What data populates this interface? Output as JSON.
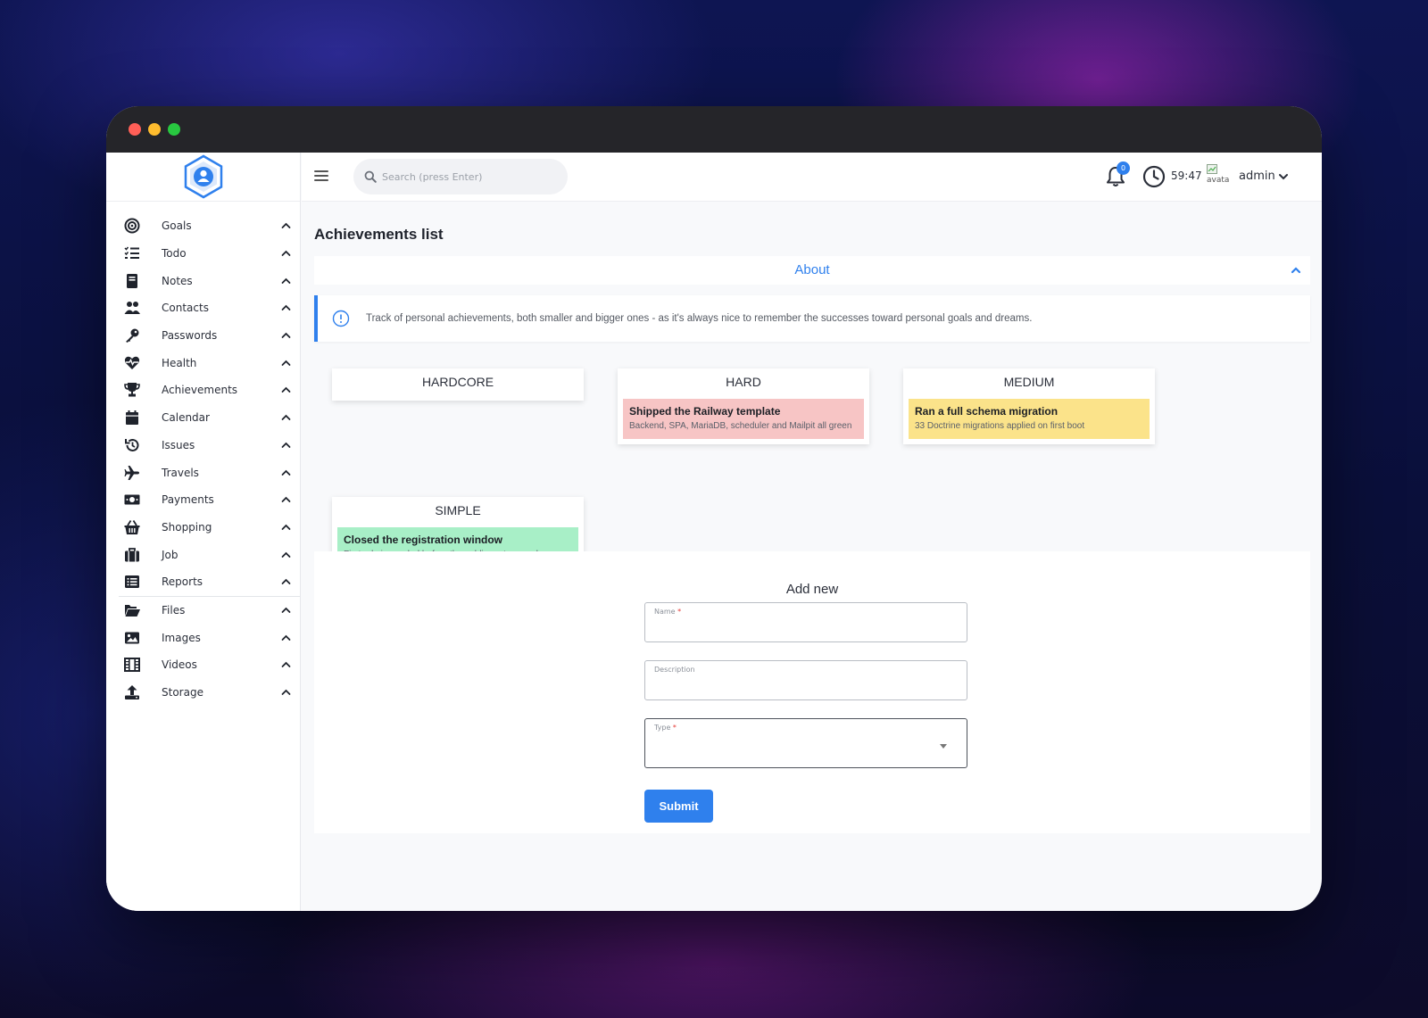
{
  "window": {
    "controls": [
      "close",
      "minimize",
      "maximize"
    ]
  },
  "sidebar": {
    "items": [
      {
        "label": "Goals",
        "icon": "target-icon"
      },
      {
        "label": "Todo",
        "icon": "checklist-icon"
      },
      {
        "label": "Notes",
        "icon": "notebook-icon"
      },
      {
        "label": "Contacts",
        "icon": "users-icon"
      },
      {
        "label": "Passwords",
        "icon": "key-icon"
      },
      {
        "label": "Health",
        "icon": "heartbeat-icon"
      },
      {
        "label": "Achievements",
        "icon": "trophy-icon"
      },
      {
        "label": "Calendar",
        "icon": "calendar-icon"
      },
      {
        "label": "Issues",
        "icon": "history-icon"
      },
      {
        "label": "Travels",
        "icon": "plane-icon"
      },
      {
        "label": "Payments",
        "icon": "money-icon"
      },
      {
        "label": "Shopping",
        "icon": "basket-icon"
      },
      {
        "label": "Job",
        "icon": "briefcase-icon"
      },
      {
        "label": "Reports",
        "icon": "list-alt-icon"
      },
      {
        "label": "Files",
        "icon": "folder-open-icon"
      },
      {
        "label": "Images",
        "icon": "image-icon"
      },
      {
        "label": "Videos",
        "icon": "film-icon"
      },
      {
        "label": "Storage",
        "icon": "upload-icon"
      }
    ]
  },
  "topbar": {
    "search_placeholder": "Search (press Enter)",
    "notifications_count": "0",
    "timer": "59:47",
    "avatar_alt": "avatar",
    "username": "admin"
  },
  "page": {
    "title": "Achievements list",
    "about_label": "About",
    "info_text": "Track of personal achievements, both smaller and bigger ones - as it's always nice to remember the successes toward personal goals and dreams."
  },
  "boards": [
    {
      "title": "HARDCORE",
      "cards": []
    },
    {
      "title": "HARD",
      "cards": [
        {
          "title": "Shipped the Railway template",
          "description": "Backend, SPA, MariaDB, scheduler and Mailpit all green",
          "color": "#f7c5c5"
        }
      ]
    },
    {
      "title": "MEDIUM",
      "cards": [
        {
          "title": "Ran a full schema migration",
          "description": "33 Doctrine migrations applied on first boot",
          "color": "#fbe38a"
        }
      ]
    },
    {
      "title": "SIMPLE",
      "cards": [
        {
          "title": "Closed the registration window",
          "description": "First admin seeded before the public port opened",
          "color": "#a8efc7"
        }
      ]
    }
  ],
  "form": {
    "title": "Add new",
    "name_label": "Name",
    "description_label": "Description",
    "type_label": "Type",
    "required_marker": "*",
    "name_value": "",
    "description_value": "",
    "type_value": "",
    "submit_label": "Submit"
  },
  "colors": {
    "accent": "#2f80ed",
    "hard": "#f7c5c5",
    "medium": "#fbe38a",
    "simple": "#a8efc7"
  }
}
